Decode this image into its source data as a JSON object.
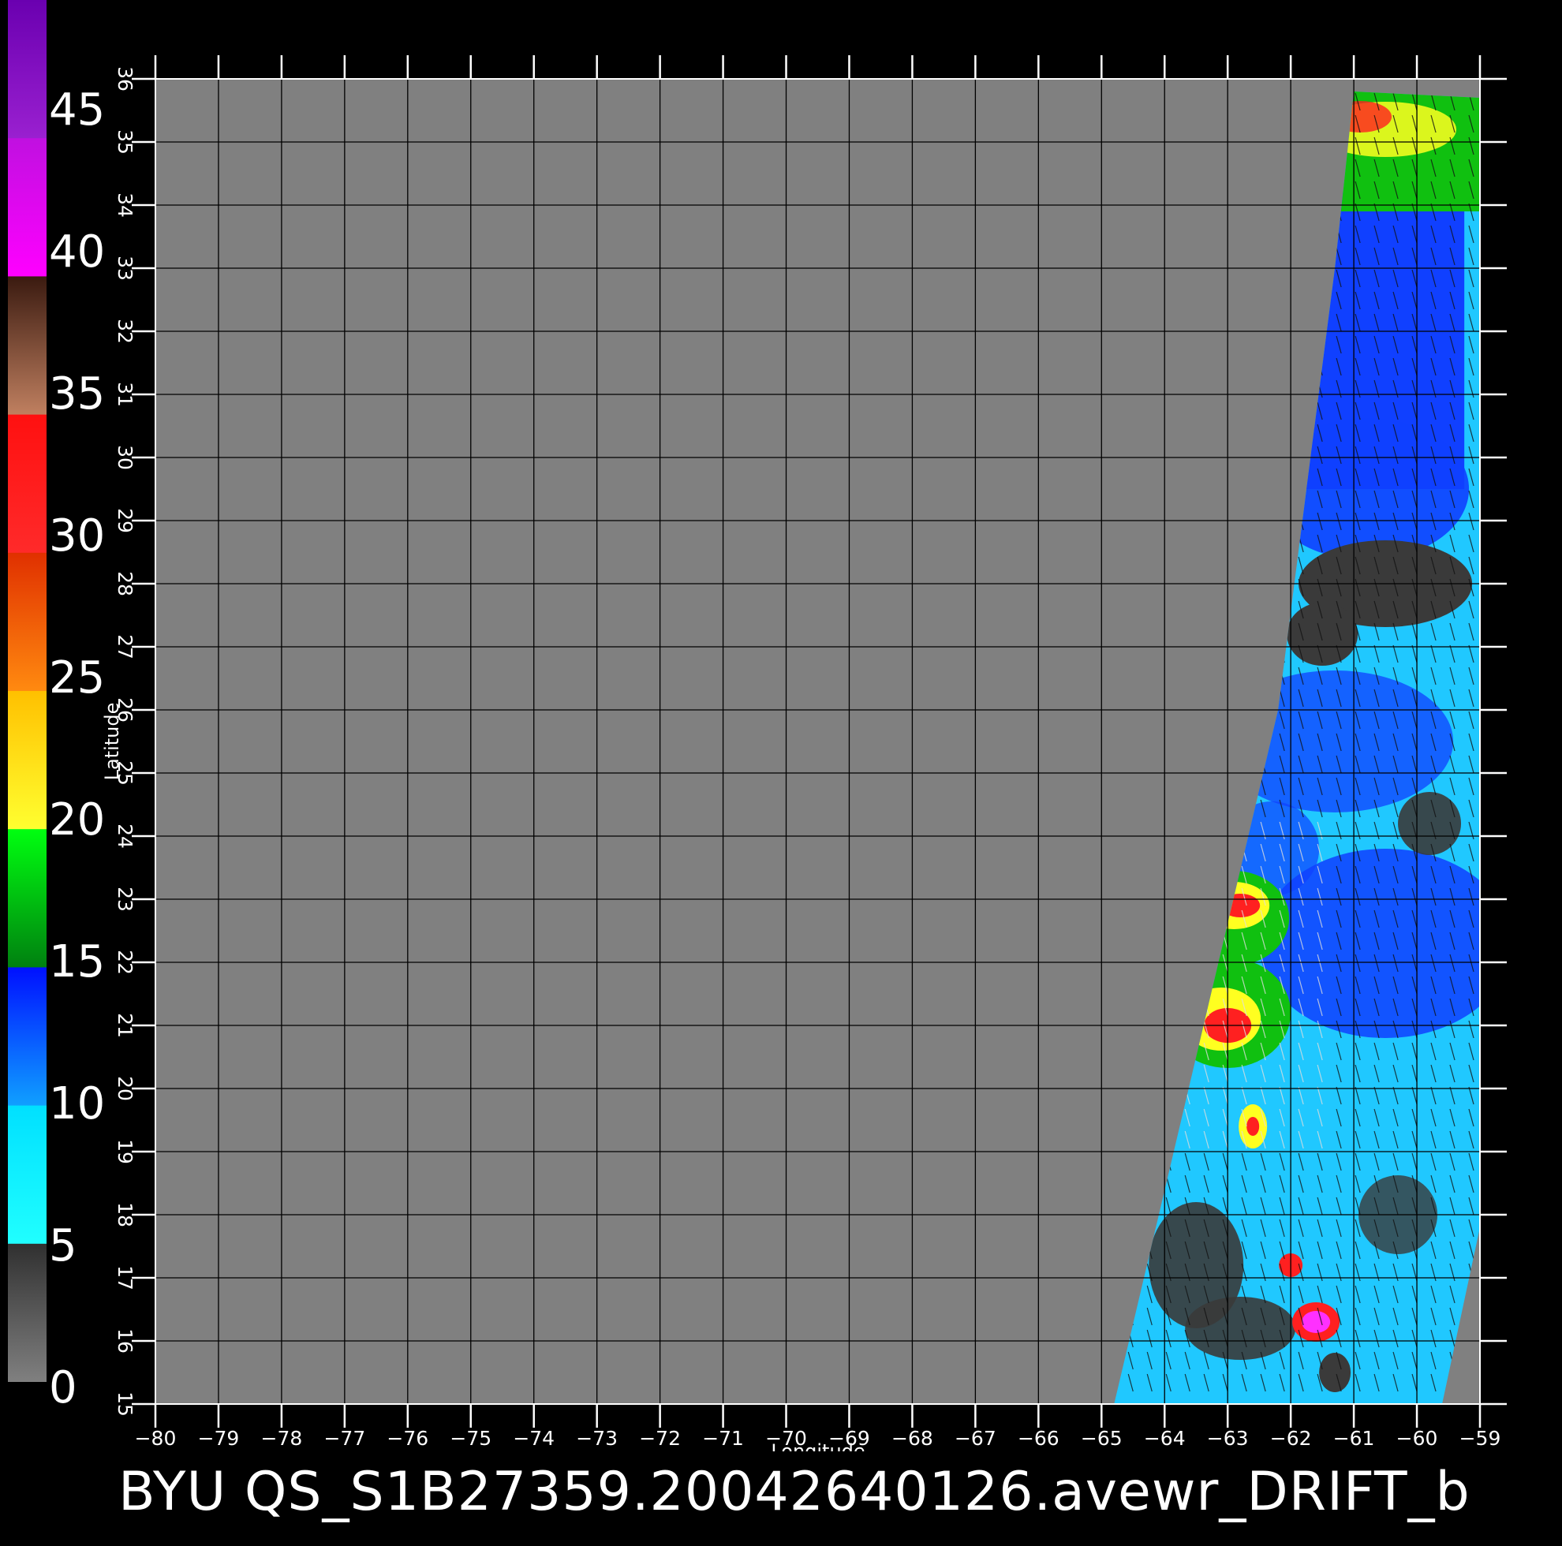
{
  "colorbar": {
    "labels": [
      "45",
      "40",
      "35",
      "30",
      "25",
      "20",
      "15",
      "10",
      "5",
      "0"
    ],
    "segments": [
      {
        "from": "#6a00b0",
        "to": "#9a20d0"
      },
      {
        "from": "#c010e0",
        "to": "#ff00ff"
      },
      {
        "from": "#3a1a10",
        "to": "#c08060"
      },
      {
        "from": "#ff1010",
        "to": "#ff2a2a"
      },
      {
        "from": "#e03000",
        "to": "#ff8a10"
      },
      {
        "from": "#ffc000",
        "to": "#ffff30"
      },
      {
        "from": "#00ff10",
        "to": "#008010"
      },
      {
        "from": "#0010ff",
        "to": "#10a0ff"
      },
      {
        "from": "#00e0ff",
        "to": "#20ffff"
      },
      {
        "from": "#303030",
        "to": "#808080"
      }
    ]
  },
  "map": {
    "lon_min": -80,
    "lon_max": -59,
    "lat_min": 15,
    "lat_max": 36,
    "lon_ticks": [
      "−80",
      "−79",
      "−78",
      "−77",
      "−76",
      "−75",
      "−74",
      "−73",
      "−72",
      "−71",
      "−70",
      "−69",
      "−68",
      "−67",
      "−66",
      "−65",
      "−64",
      "−63",
      "−62",
      "−61",
      "−60",
      "−59"
    ],
    "lat_ticks": [
      "15",
      "16",
      "17",
      "18",
      "19",
      "20",
      "21",
      "22",
      "23",
      "24",
      "25",
      "26",
      "27",
      "28",
      "29",
      "30",
      "31",
      "32",
      "33",
      "34",
      "35",
      "36"
    ],
    "xlabel": "Longitude",
    "ylabel": "Latitude",
    "background_color": "#808080",
    "swath_colors": {
      "low_wind_dark": "#3a3a3a",
      "cyan": "#20c8ff",
      "blue": "#1040ff",
      "green": "#10c010",
      "yellow": "#ffff20",
      "red": "#ff2020",
      "magenta": "#ff30ff"
    }
  },
  "footer": {
    "title": "BYU  QS_S1B27359.20042640126.avewr_DRIFT_b"
  }
}
